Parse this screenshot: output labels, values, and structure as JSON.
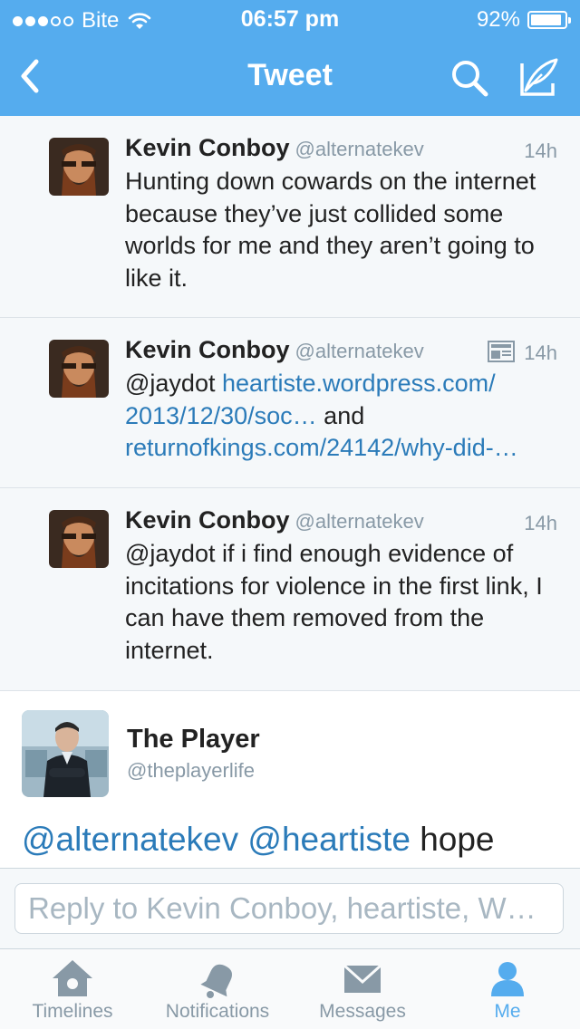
{
  "status_bar": {
    "carrier": "Bite",
    "time": "06:57 pm",
    "battery": "92%",
    "battery_level": 0.92
  },
  "nav": {
    "title": "Tweet"
  },
  "tweets": [
    {
      "name": "Kevin Conboy",
      "handle": "@alternatekev",
      "time": "14h",
      "text": "Hunting down cowards on the internet because they’ve just collided some worlds for me and they aren’t going to like it."
    },
    {
      "name": "Kevin Conboy",
      "handle": "@alternatekev",
      "time": "14h",
      "mention": "@jaydot",
      "link1": "heartiste.wordpress.com/ 2013/12/30/soc…",
      "and": "and",
      "link2": "returnofkings.com/24142/why-did-…"
    },
    {
      "name": "Kevin Conboy",
      "handle": "@alternatekev",
      "time": "14h",
      "text": "@jaydot if i find enough evidence of incitations for violence in the first link, I can have them removed from the internet."
    }
  ],
  "focus_tweet": {
    "name": "The Player",
    "handle": "@theplayerlife",
    "mention1": "@alternatekev",
    "mention2": "@heartiste",
    "text": "hope"
  },
  "reply": {
    "placeholder": "Reply to Kevin Conboy, heartiste, W…"
  },
  "tabs": [
    {
      "label": "Timelines",
      "icon": "home-icon",
      "active": false
    },
    {
      "label": "Notifications",
      "icon": "bell-icon",
      "active": false
    },
    {
      "label": "Messages",
      "icon": "envelope-icon",
      "active": false
    },
    {
      "label": "Me",
      "icon": "person-icon",
      "active": true
    }
  ],
  "colors": {
    "brand": "#55acee",
    "link": "#2b7bb9",
    "muted": "#8899a6"
  }
}
